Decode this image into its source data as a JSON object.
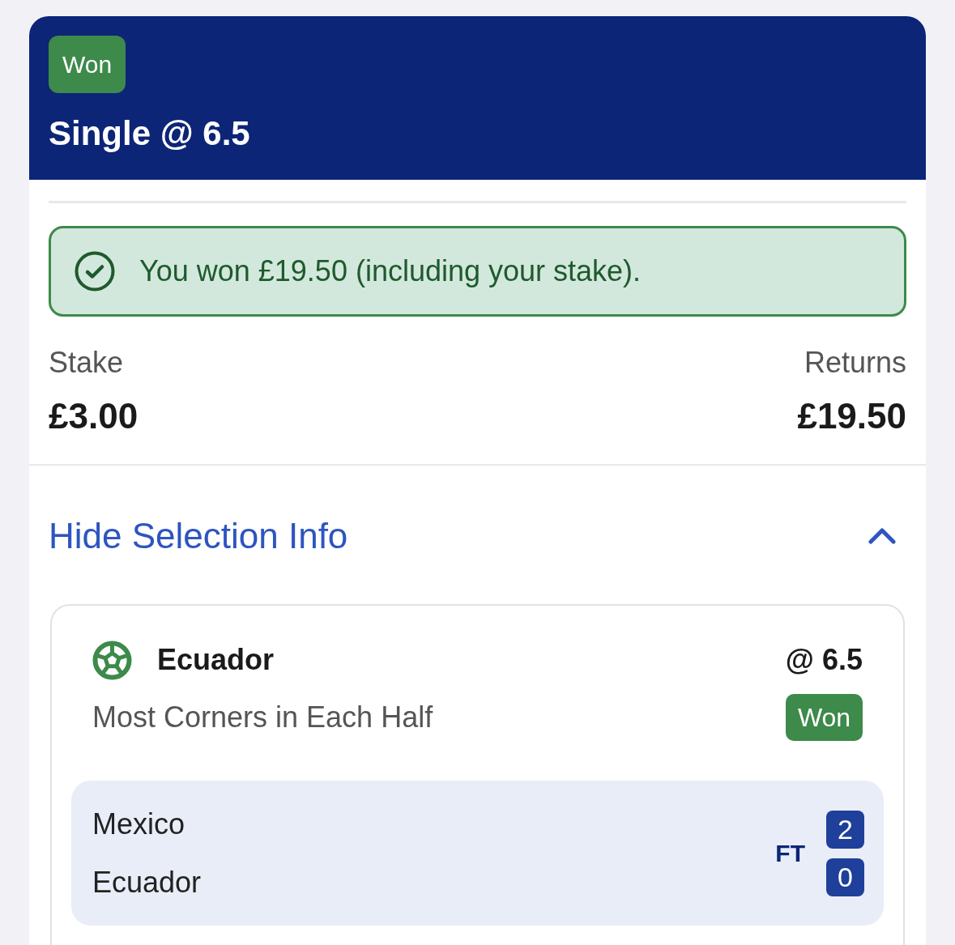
{
  "bet": {
    "status": "Won",
    "title": "Single @ 6.5"
  },
  "result_banner": {
    "message": "You won £19.50 (including your stake)."
  },
  "summary": {
    "stake_label": "Stake",
    "stake": "£3.00",
    "returns_label": "Returns",
    "returns": "£19.50"
  },
  "selection_toggle": {
    "label": "Hide Selection Info",
    "expanded": true
  },
  "selection": {
    "name": "Ecuador",
    "odds": "@ 6.5",
    "market": "Most Corners in Each Half",
    "status": "Won",
    "match": {
      "period": "FT",
      "teams": [
        {
          "name": "Mexico",
          "score": "2"
        },
        {
          "name": "Ecuador",
          "score": "0"
        }
      ]
    }
  }
}
